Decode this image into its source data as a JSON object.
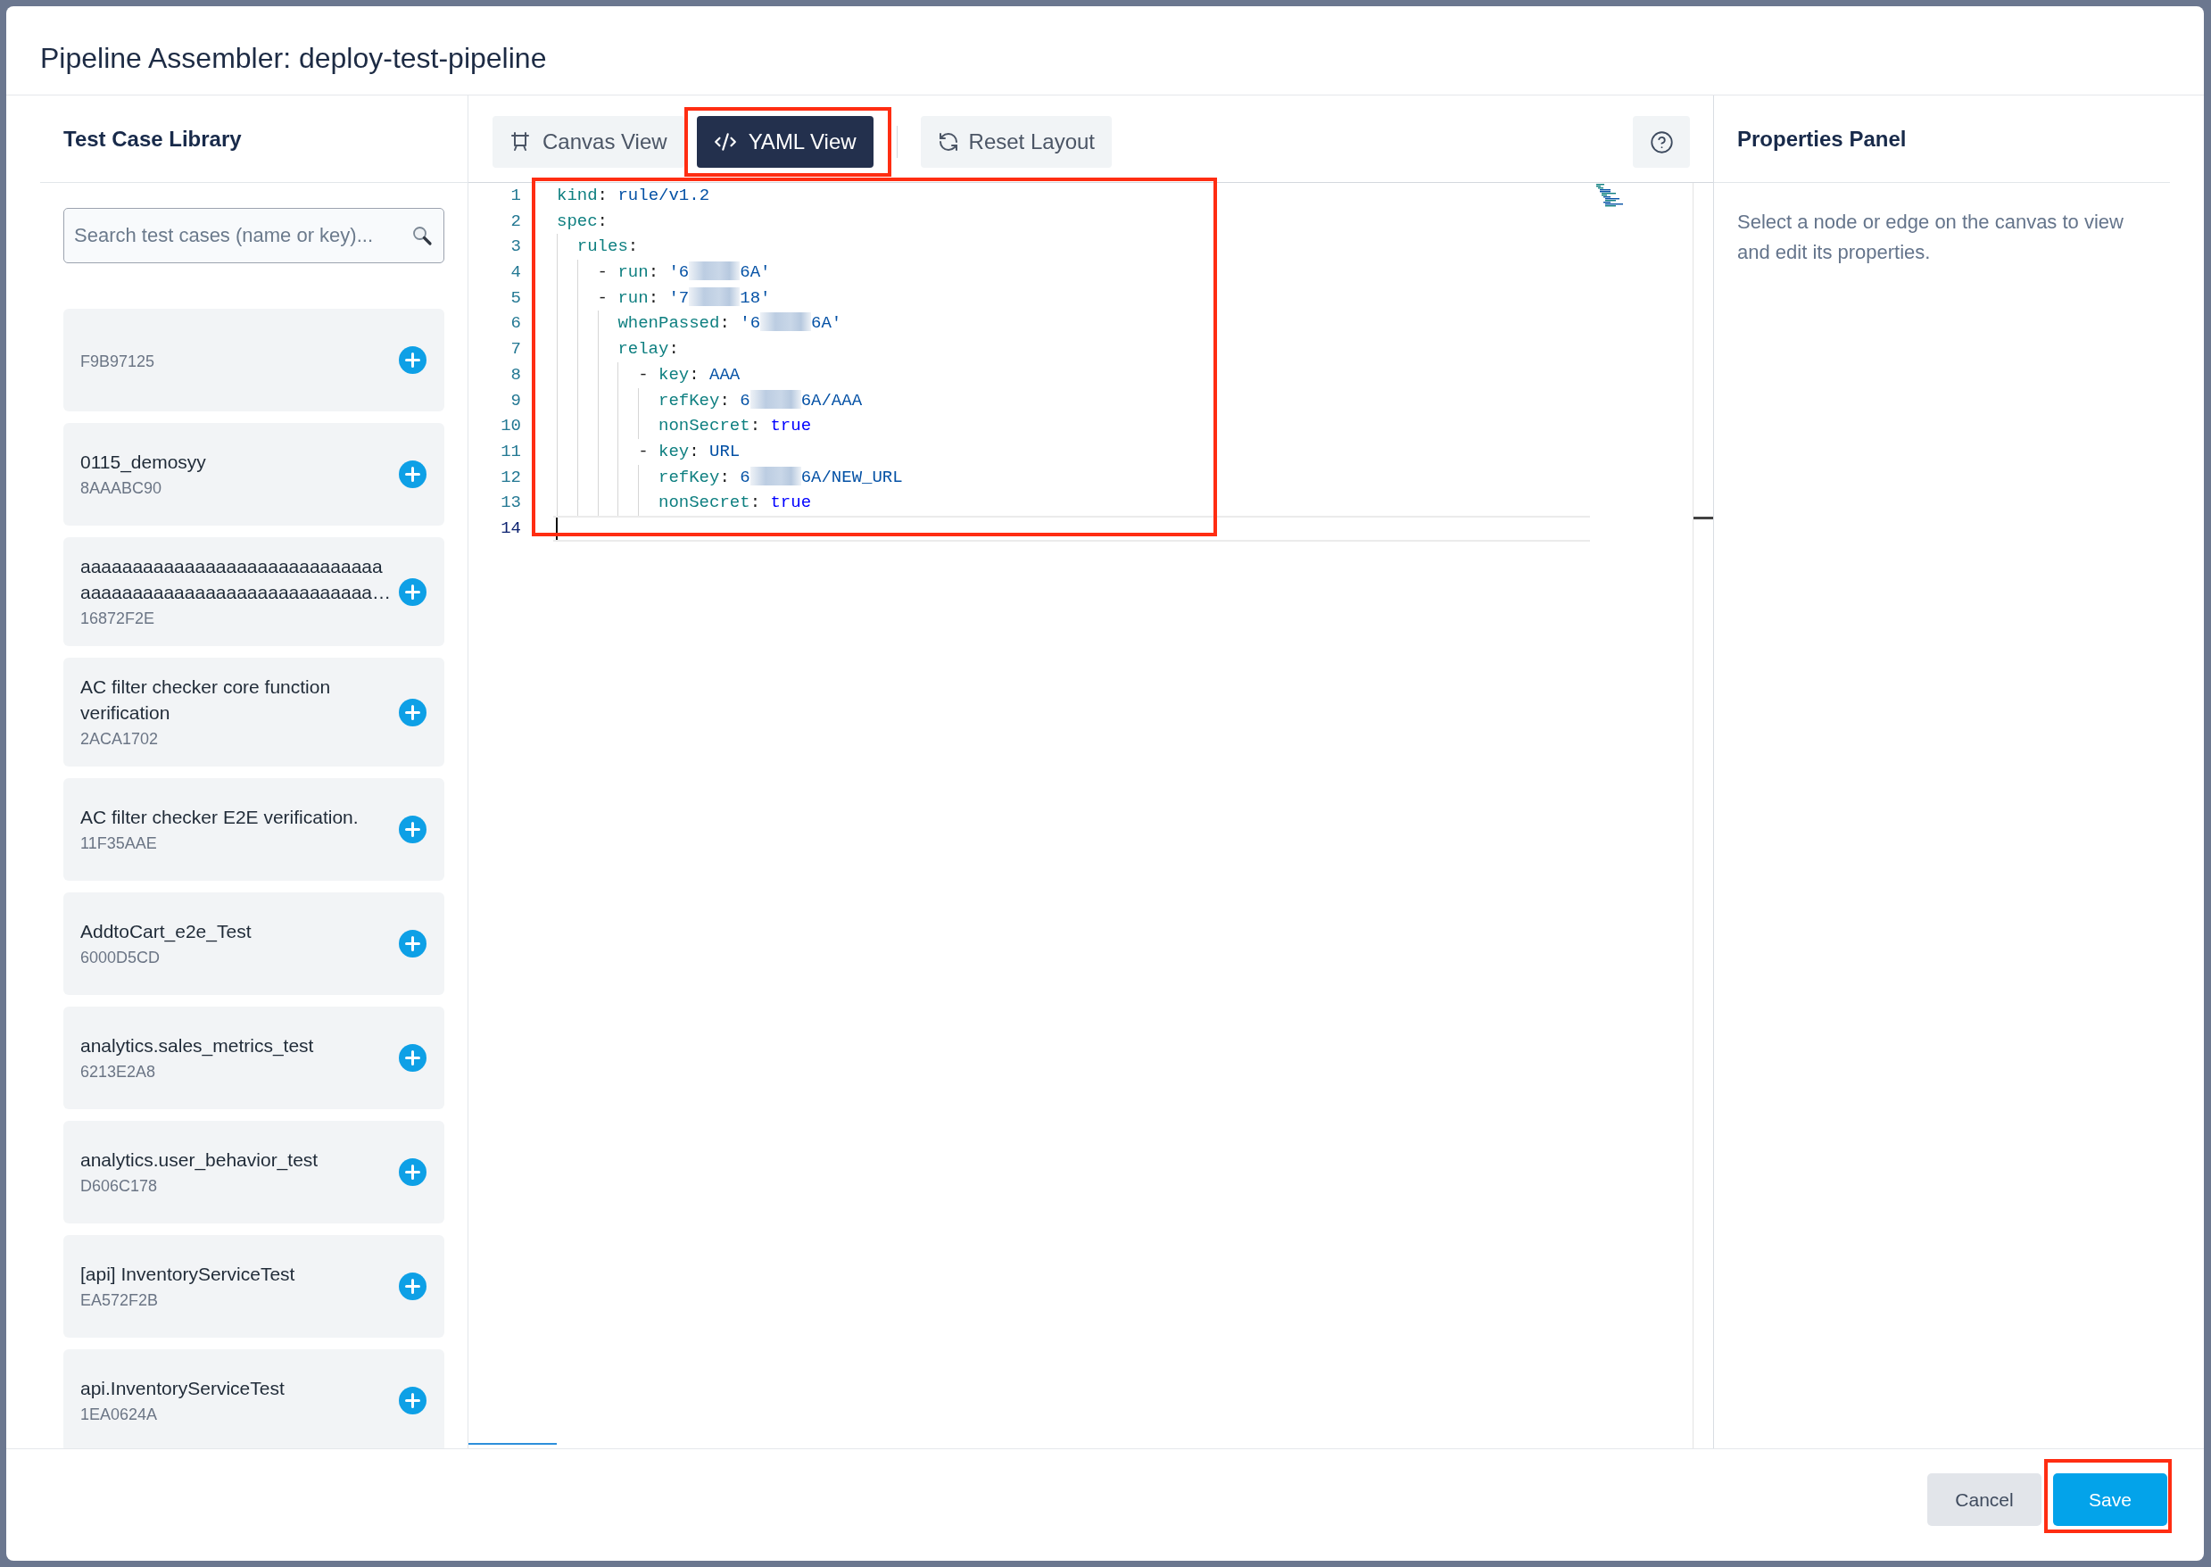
{
  "dialog": {
    "title": "Pipeline Assembler: deploy-test-pipeline"
  },
  "library": {
    "title": "Test Case Library",
    "search": {
      "placeholder": "Search test cases (name or key)..."
    },
    "items": [
      {
        "key": "F9B97125"
      },
      {
        "name": "0115_demosyy",
        "key": "8AAABC90"
      },
      {
        "name": "aaaaaaaaaaaaaaaaaaaaaaaaaaaaaaaaaaaaaaaaaaaaaaaaaaaaaaaaa…",
        "key": "16872F2E"
      },
      {
        "name": "AC filter checker core function verification",
        "key": "2ACA1702"
      },
      {
        "name": "AC filter checker E2E verification.",
        "key": "11F35AAE"
      },
      {
        "name": "AddtoCart_e2e_Test",
        "key": "6000D5CD"
      },
      {
        "name": "analytics.sales_metrics_test",
        "key": "6213E2A8"
      },
      {
        "name": "analytics.user_behavior_test",
        "key": "D606C178"
      },
      {
        "name": "[api] InventoryServiceTest",
        "key": "EA572F2B"
      },
      {
        "name": "api.InventoryServiceTest",
        "key": "1EA0624A"
      }
    ]
  },
  "toolbar": {
    "views": [
      {
        "label": "Canvas View",
        "selected": false,
        "annotated": false
      },
      {
        "label": "YAML View",
        "selected": true,
        "annotated": true
      }
    ],
    "actions": [
      {
        "label": "Reset Layout"
      }
    ]
  },
  "editor": {
    "annotated": true,
    "lines": [
      {
        "number": "1",
        "active": false,
        "tokens": [
          {
            "kind": "key",
            "text": "kind"
          },
          {
            "kind": "punct",
            "text": ": "
          },
          {
            "kind": "value",
            "text": "rule/v1.2"
          }
        ]
      },
      {
        "number": "2",
        "active": false,
        "tokens": [
          {
            "kind": "key",
            "text": "spec"
          },
          {
            "kind": "punct",
            "text": ":"
          }
        ],
        "children": [
          {
            "number": "3",
            "active": false,
            "tokens": [
              {
                "kind": "key",
                "text": "rules"
              },
              {
                "kind": "punct",
                "text": ":"
              }
            ],
            "children": [
              {
                "number": "4",
                "active": false,
                "tokens": [
                  {
                    "kind": "punct",
                    "text": "- "
                  },
                  {
                    "kind": "key",
                    "text": "run"
                  },
                  {
                    "kind": "punct",
                    "text": ": "
                  },
                  {
                    "kind": "value",
                    "text": "'6"
                  },
                  {
                    "kind": "redacted"
                  },
                  {
                    "kind": "value",
                    "text": "6A'"
                  }
                ]
              },
              {
                "number": "5",
                "active": false,
                "tokens": [
                  {
                    "kind": "punct",
                    "text": "- "
                  },
                  {
                    "kind": "key",
                    "text": "run"
                  },
                  {
                    "kind": "punct",
                    "text": ": "
                  },
                  {
                    "kind": "value",
                    "text": "'7"
                  },
                  {
                    "kind": "redacted"
                  },
                  {
                    "kind": "value",
                    "text": "18'"
                  }
                ],
                "children": [
                  {
                    "number": "6",
                    "active": false,
                    "tokens": [
                      {
                        "kind": "key",
                        "text": "whenPassed"
                      },
                      {
                        "kind": "punct",
                        "text": ": "
                      },
                      {
                        "kind": "value",
                        "text": "'6"
                      },
                      {
                        "kind": "redacted"
                      },
                      {
                        "kind": "value",
                        "text": "6A'"
                      }
                    ]
                  },
                  {
                    "number": "7",
                    "active": false,
                    "tokens": [
                      {
                        "kind": "key",
                        "text": "relay"
                      },
                      {
                        "kind": "punct",
                        "text": ":"
                      }
                    ],
                    "children": [
                      {
                        "number": "8",
                        "active": false,
                        "tokens": [
                          {
                            "kind": "punct",
                            "text": "- "
                          },
                          {
                            "kind": "key",
                            "text": "key"
                          },
                          {
                            "kind": "punct",
                            "text": ": "
                          },
                          {
                            "kind": "value",
                            "text": "AAA"
                          }
                        ],
                        "children": [
                          {
                            "number": "9",
                            "active": false,
                            "tokens": [
                              {
                                "kind": "key",
                                "text": "refKey"
                              },
                              {
                                "kind": "punct",
                                "text": ": "
                              },
                              {
                                "kind": "value",
                                "text": "6"
                              },
                              {
                                "kind": "redacted"
                              },
                              {
                                "kind": "value",
                                "text": "6A/AAA"
                              }
                            ]
                          },
                          {
                            "number": "10",
                            "active": false,
                            "tokens": [
                              {
                                "kind": "key",
                                "text": "nonSecret"
                              },
                              {
                                "kind": "punct",
                                "text": ": "
                              },
                              {
                                "kind": "bool",
                                "text": "true"
                              }
                            ]
                          }
                        ]
                      },
                      {
                        "number": "11",
                        "active": false,
                        "tokens": [
                          {
                            "kind": "punct",
                            "text": "- "
                          },
                          {
                            "kind": "key",
                            "text": "key"
                          },
                          {
                            "kind": "punct",
                            "text": ": "
                          },
                          {
                            "kind": "value",
                            "text": "URL"
                          }
                        ],
                        "children": [
                          {
                            "number": "12",
                            "active": false,
                            "tokens": [
                              {
                                "kind": "key",
                                "text": "refKey"
                              },
                              {
                                "kind": "punct",
                                "text": ": "
                              },
                              {
                                "kind": "value",
                                "text": "6"
                              },
                              {
                                "kind": "redacted"
                              },
                              {
                                "kind": "value",
                                "text": "6A/NEW_URL"
                              }
                            ]
                          },
                          {
                            "number": "13",
                            "active": false,
                            "tokens": [
                              {
                                "kind": "key",
                                "text": "nonSecret"
                              },
                              {
                                "kind": "punct",
                                "text": ": "
                              },
                              {
                                "kind": "bool",
                                "text": "true"
                              }
                            ]
                          }
                        ]
                      }
                    ]
                  }
                ]
              }
            ]
          }
        ]
      },
      {
        "number": "14",
        "active": true
      }
    ]
  },
  "properties": {
    "title": "Properties Panel",
    "hint": "Select a node or edge on the canvas to view and edit its properties."
  },
  "footer": {
    "buttons": [
      {
        "label": "Cancel",
        "kind": "secondary",
        "annotated": false
      },
      {
        "label": "Save",
        "kind": "primary",
        "annotated": true
      }
    ]
  }
}
